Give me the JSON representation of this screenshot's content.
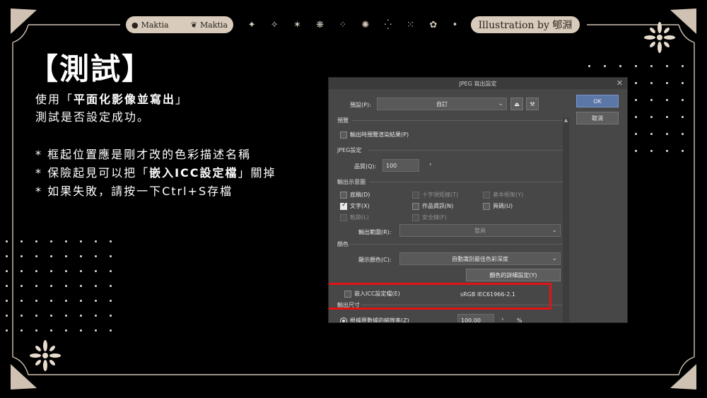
{
  "banner": {
    "brand_left_1": "Maktia",
    "brand_left_2": "Maktia",
    "credit": "Illustration by 郇淵",
    "stars": [
      "✦",
      "✧",
      "✶",
      "❋",
      "⁘",
      "✺",
      "⁛",
      "⁙",
      "✿",
      "•"
    ]
  },
  "slide": {
    "title": "【測試】",
    "intro_prefix": "使用「",
    "intro_bold": "平面化影像並寫出",
    "intro_suffix": "」",
    "intro_line2": "測試是否設定成功。",
    "bullet1": "* 框起位置應是剛才改的色彩描述名稱",
    "bullet2_prefix": "* 保險起見可以把「",
    "bullet2_bold": "嵌入ICC設定檔",
    "bullet2_suffix": "」關掉",
    "bullet3": "* 如果失敗，請按一下Ctrl+S存檔"
  },
  "dialog": {
    "title": "JPEG 寫出設定",
    "close": "✕",
    "preset_label": "預設(P):",
    "preset_value": "自訂",
    "ok": "OK",
    "cancel": "取消",
    "preview_section": "預覽",
    "preview_check": "輸出時預覽渲染結果(P)",
    "jpeg_section": "JPEG設定",
    "quality_label": "品質(Q):",
    "quality_value": "100",
    "output_section": "輸出示意圖",
    "opt_sketch": "底稿(D)",
    "opt_crosshair": "十字規矩線(T)",
    "opt_frame": "基本框架(Y)",
    "opt_text": "文字(X)",
    "opt_info": "作品資訊(N)",
    "opt_page": "頁碼(U)",
    "opt_trace": "軌跡(L)",
    "opt_safe": "安全線(F)",
    "range_label": "輸出範圍(R):",
    "range_value": "整頁",
    "color_section": "顏色",
    "display_color_label": "顯示顏色(C):",
    "display_color_value": "自動識別最佳色彩深度",
    "color_detail_btn": "顏色的詳細設定(Y)",
    "embed_icc": "嵌入ICC設定檔(E)",
    "icc_profile": "sRGB IEC61966-2.1",
    "size_section": "輸出尺寸",
    "scale_radio": "根據原數據的縮放率(Z)",
    "scale_value": "100.00",
    "scale_unit": "%"
  }
}
